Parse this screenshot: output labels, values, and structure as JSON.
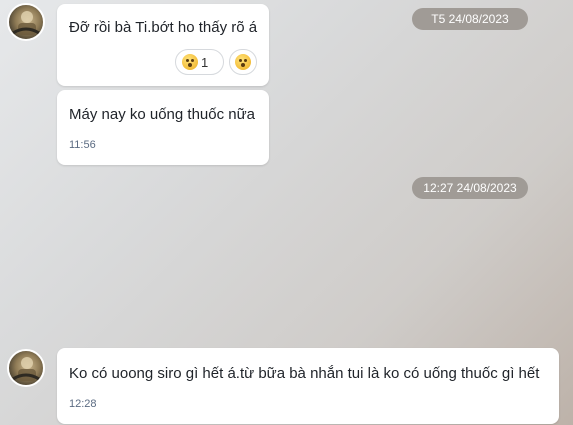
{
  "date_separators": [
    {
      "text": "T5 24/08/2023"
    },
    {
      "text": "12:27 24/08/2023"
    }
  ],
  "messages": [
    {
      "text": "Đỡ rồi bà Ti.bớt ho thấy rõ á",
      "reactions": [
        {
          "emoji": "astonished-face",
          "count": "1"
        },
        {
          "emoji": "astonished-face"
        }
      ]
    },
    {
      "text": "Máy nay ko uống thuốc nữa",
      "time": "11:56"
    },
    {
      "text": "Ko có uoong siro gì hết á.từ bữa bà nhắn tui là ko có uống thuốc gì hết",
      "time": "12:28"
    }
  ],
  "colors": {
    "bubble": "#ffffff",
    "timestamp_pill": "#a09b96",
    "time_text": "#5b6b82"
  }
}
